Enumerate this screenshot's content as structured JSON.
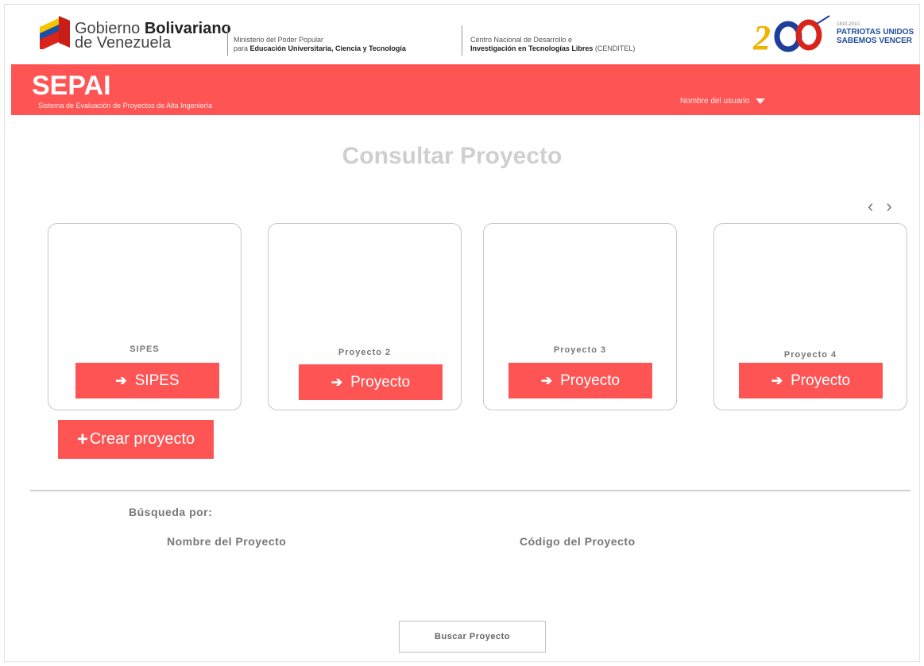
{
  "gov_header": {
    "gobierno_prefix": "Gobierno ",
    "gobierno_bold": "Bolivariano",
    "gobierno_line2": "de Venezuela",
    "ministry_line1": "Ministerio del Poder Popular",
    "ministry_line2_prefix": "para ",
    "ministry_line2_bold": "Educación Universitaria, Ciencia y Tecnología",
    "centro_line1": "Centro Nacional de Desarrollo e",
    "centro_line2_bold": "Investigación en Tecnologías Libres",
    "centro_line2_suffix": " (CENDITEL)",
    "years": "1810-2010",
    "slogan_line1": "PATRIOTAS UNIDOS",
    "slogan_line2": "SABEMOS VENCER"
  },
  "navbar": {
    "brand": "SEPAI",
    "subtitle": "Sistema de Evaluación de Proyectos de Alta Ingeniería",
    "user_label": "Nombre del usuario",
    "bg_color": "#ff5454"
  },
  "page_title": "Consultar Proyecto",
  "carousel": {
    "prev": "‹",
    "next": "›",
    "cards": [
      {
        "label": "SIPES",
        "button": "SIPES"
      },
      {
        "label": "Proyecto 2",
        "button": "Proyecto"
      },
      {
        "label": "Proyecto 3",
        "button": "Proyecto"
      },
      {
        "label": "Proyecto 4",
        "button": "Proyecto"
      }
    ]
  },
  "create_button": "Crear proyecto",
  "search": {
    "heading": "Búsqueda por:",
    "name_label": "Nombre del Proyecto",
    "code_label": "Código del Proyecto",
    "button": "Buscar Proyecto"
  },
  "icons": {
    "arrow": "arrow-right-icon",
    "plus": "plus-icon",
    "caret": "caret-down-icon"
  }
}
